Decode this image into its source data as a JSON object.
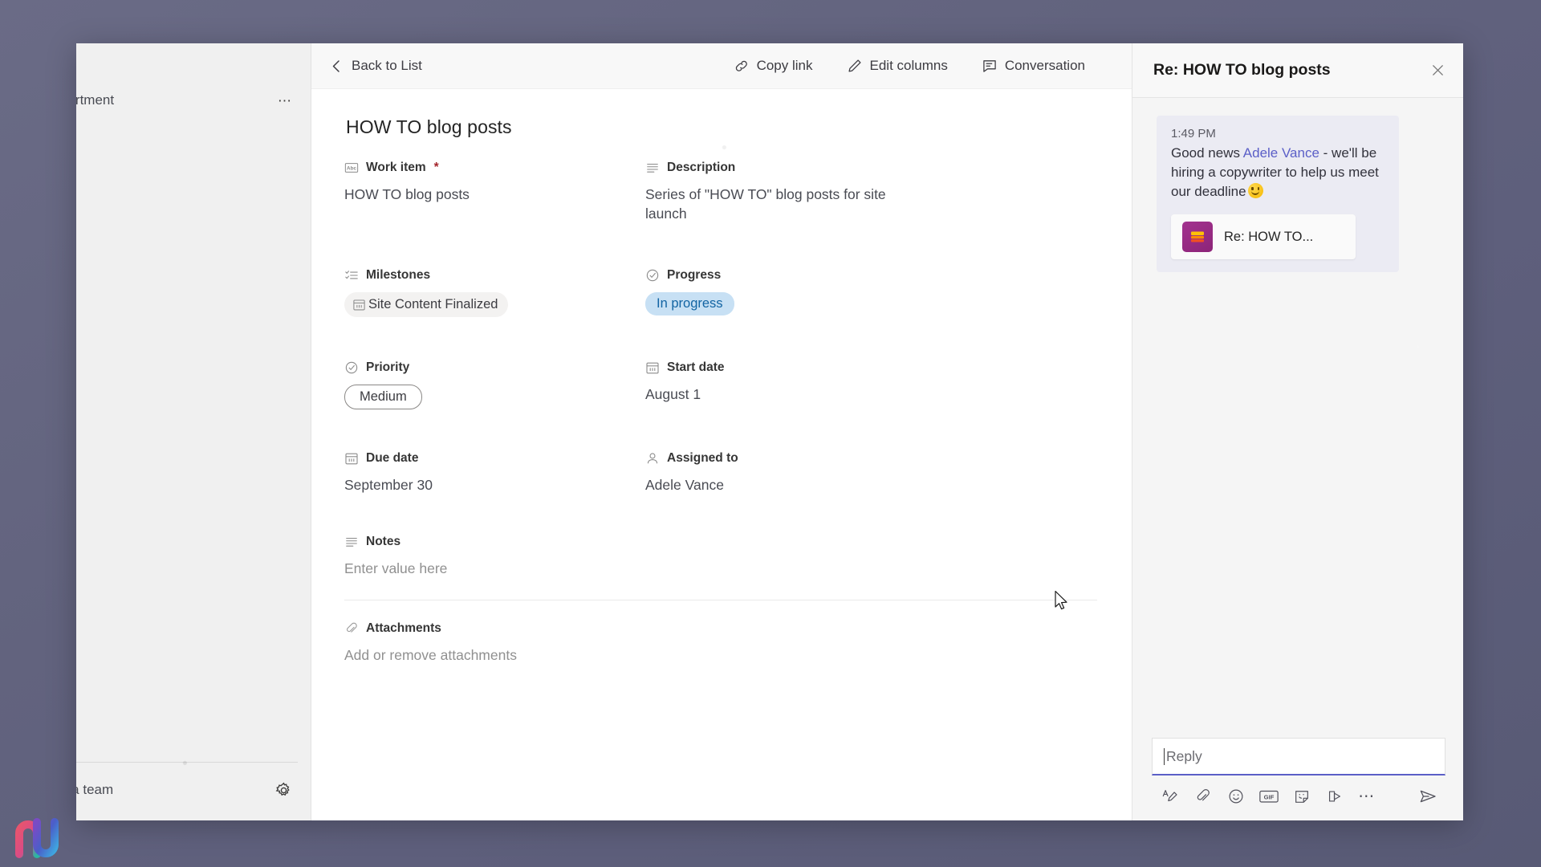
{
  "window": {
    "left_rail": {
      "team_name": "partment",
      "team_overflow_icon": "more-horizontal-icon",
      "join_team_label": "e a team",
      "settings_icon": "gear-icon"
    },
    "toolbar": {
      "back_label": "Back to List",
      "back_icon": "chevron-left-icon",
      "copy_link_label": "Copy link",
      "copy_link_icon": "link-icon",
      "edit_columns_label": "Edit columns",
      "edit_columns_icon": "pencil-icon",
      "conversation_label": "Conversation",
      "conversation_icon": "chat-icon"
    },
    "record": {
      "title": "HOW TO blog posts",
      "fields": [
        {
          "label": "Work item",
          "required": true,
          "icon": "abc-text-icon",
          "value": "HOW TO blog posts",
          "type": "text"
        },
        {
          "label": "Description",
          "required": false,
          "icon": "lines-icon",
          "value": "Series of \"HOW TO\" blog posts for site launch",
          "type": "text"
        },
        {
          "label": "Milestones",
          "required": false,
          "icon": "checklist-icon",
          "value": "Site Content Finalized",
          "type": "chip",
          "chip_icon": "calendar-icon"
        },
        {
          "label": "Progress",
          "required": false,
          "icon": "check-circle-icon",
          "value": "In progress",
          "type": "pill",
          "pill_bg": "#c7e0f4",
          "pill_fg": "#1264a3"
        },
        {
          "label": "Priority",
          "required": false,
          "icon": "check-circle-icon",
          "value": "Medium",
          "type": "pill-outline"
        },
        {
          "label": "Start date",
          "required": false,
          "icon": "calendar-icon",
          "value": "August 1",
          "type": "text"
        },
        {
          "label": "Due date",
          "required": false,
          "icon": "calendar-icon",
          "value": "September 30",
          "type": "text"
        },
        {
          "label": "Assigned to",
          "required": false,
          "icon": "person-icon",
          "value": "Adele Vance",
          "type": "text"
        },
        {
          "label": "Notes",
          "required": false,
          "icon": "lines-icon",
          "value": "Enter value here",
          "type": "placeholder"
        },
        {
          "label": "Attachments",
          "required": false,
          "icon": "paperclip-icon",
          "value": "Add or remove attachments",
          "type": "placeholder"
        }
      ]
    },
    "conversation": {
      "title": "Re: HOW TO blog posts",
      "close_icon": "close-icon",
      "messages": [
        {
          "time": "1:49 PM",
          "text_before_mention": "Good news ",
          "mention": "Adele Vance",
          "text_after_mention": " - we'll be hiring a copywriter to help us meet our deadline",
          "emoji": "smiling-face",
          "card_title": "Re: HOW TO...",
          "card_icon": "lists-app-icon"
        }
      ],
      "composer": {
        "placeholder": "Reply",
        "icons": [
          "format-text-icon",
          "attach-paperclip-icon",
          "emoji-icon",
          "giphy-icon",
          "sticker-icon",
          "stream-icon",
          "more-actions-icon"
        ],
        "send_icon": "send-icon",
        "giphy_label": "GIF"
      }
    }
  },
  "desktop": {
    "logo_icon": "app-logo-icon"
  },
  "colors": {
    "accent": "#5b5fc7",
    "progress_pill_bg": "#c7e0f4",
    "progress_pill_fg": "#1264a3",
    "required_asterisk": "#a4262c",
    "wallpaper": "#62637e"
  }
}
